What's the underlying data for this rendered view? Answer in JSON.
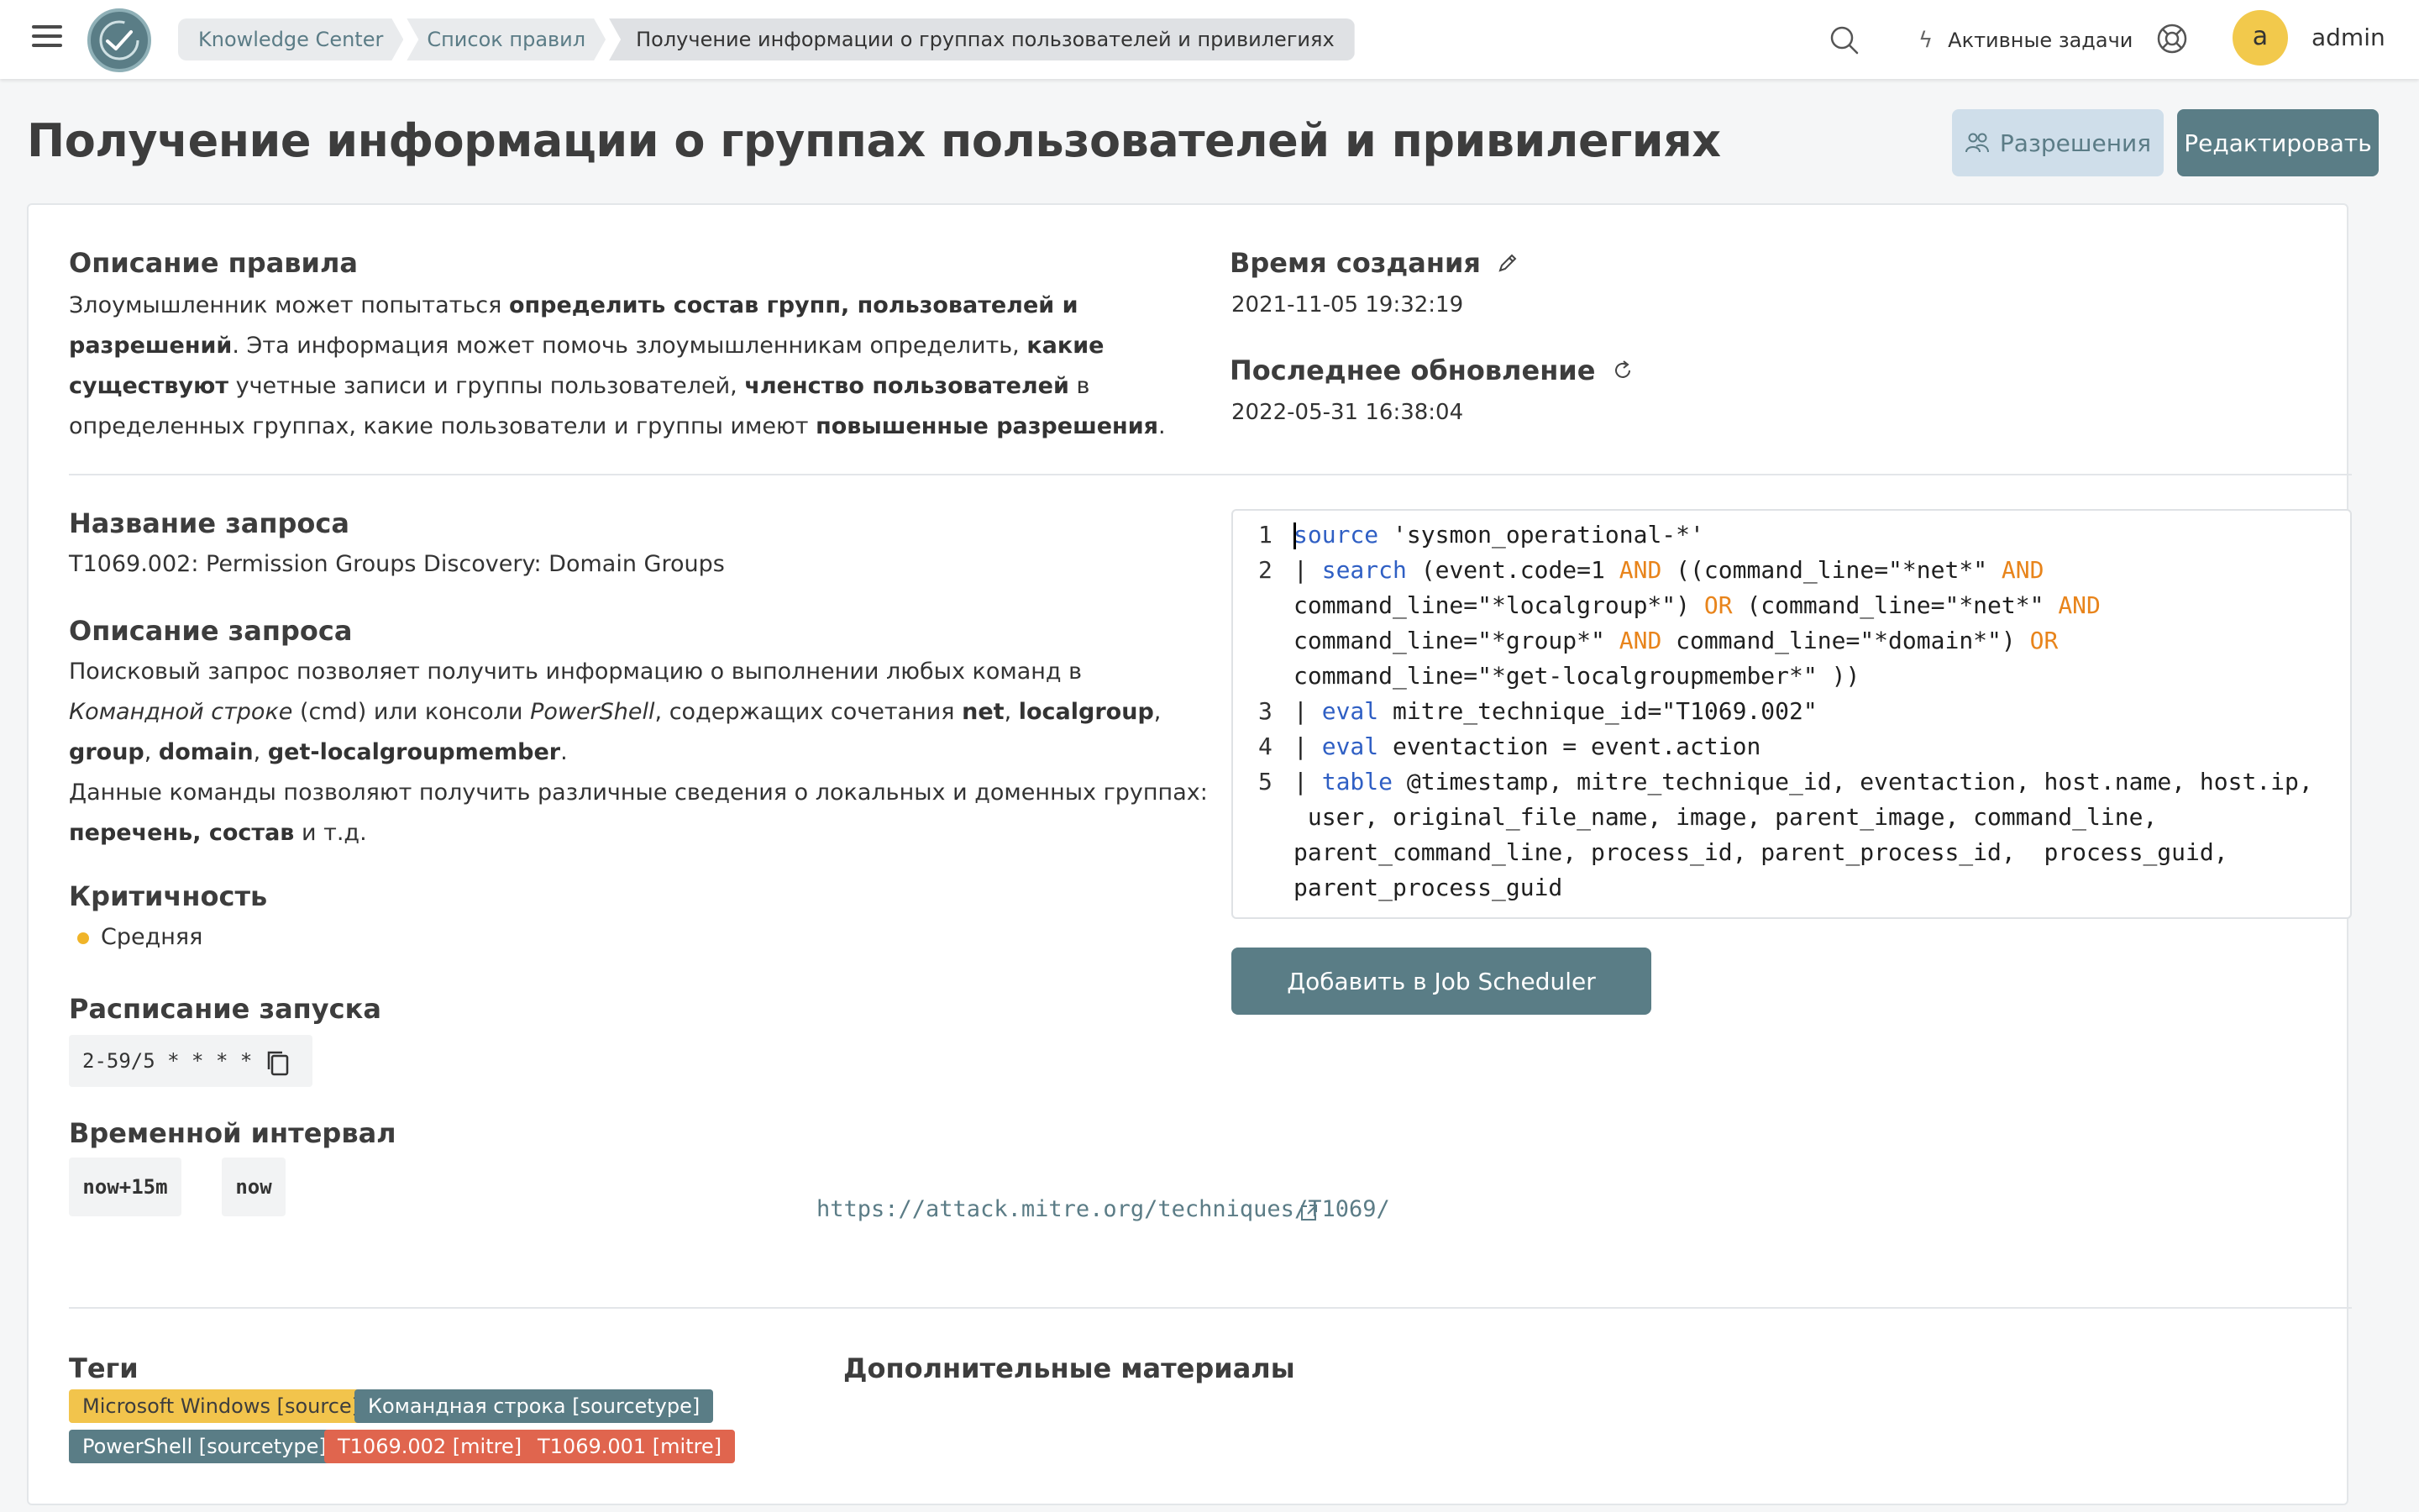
{
  "header": {
    "breadcrumb": [
      "Knowledge Center",
      "Список правил",
      "Получение информации о группах пользователей и привилегиях"
    ],
    "active_tasks_label": "Активные задачи",
    "avatar_letter": "a",
    "username": "admin"
  },
  "page": {
    "title": "Получение информации о группах пользователей и привилегиях",
    "permissions_button": "Разрешения",
    "edit_button": "Редактировать"
  },
  "rule": {
    "description_heading": "Описание правила",
    "description_segments": [
      {
        "text": "Злоумышленник может попытаться ",
        "bold": false
      },
      {
        "text": "определить состав групп, пользователей и разрешений",
        "bold": true
      },
      {
        "text": ". Эта информация может помочь злоумышленникам определить, ",
        "bold": false
      },
      {
        "text": "какие существуют",
        "bold": true
      },
      {
        "text": " учетные записи и группы пользователей, ",
        "bold": false
      },
      {
        "text": "членство пользователей",
        "bold": true
      },
      {
        "text": " в определенных группах, какие пользователи и группы имеют ",
        "bold": false
      },
      {
        "text": "повышенные разрешения",
        "bold": true
      },
      {
        "text": ".",
        "bold": false
      }
    ],
    "created_heading": "Время создания",
    "created_value": "2021-11-05 19:32:19",
    "updated_heading": "Последнее обновление",
    "updated_value": "2022-05-31 16:38:04",
    "query_name_heading": "Название запроса",
    "query_name_value": "T1069.002: Permission Groups Discovery: Domain Groups",
    "query_desc_heading": "Описание запроса",
    "query_desc_segments": [
      {
        "text": "Поисковый запрос позволяет получить информацию о выполнении любых команд в ",
        "style": "normal"
      },
      {
        "text": "Командной строке",
        "style": "italic"
      },
      {
        "text": " (cmd) или консоли ",
        "style": "normal"
      },
      {
        "text": "PowerShell",
        "style": "italic"
      },
      {
        "text": ", содержащих сочетания ",
        "style": "normal"
      },
      {
        "text": "net",
        "style": "bold"
      },
      {
        "text": ", ",
        "style": "normal"
      },
      {
        "text": "localgroup",
        "style": "bold"
      },
      {
        "text": ", ",
        "style": "normal"
      },
      {
        "text": "group",
        "style": "bold"
      },
      {
        "text": ", ",
        "style": "normal"
      },
      {
        "text": "domain",
        "style": "bold"
      },
      {
        "text": ", ",
        "style": "normal"
      },
      {
        "text": "get-localgroupmember",
        "style": "bold"
      },
      {
        "text": ".",
        "style": "normal"
      }
    ],
    "query_desc_segments_2": [
      {
        "text": "Данные команды позволяют получить различные сведения о локальных и доменных группах: ",
        "style": "normal"
      },
      {
        "text": "перечень",
        "style": "bold"
      },
      {
        "text": ", ",
        "style": "bold"
      },
      {
        "text": "состав",
        "style": "bold"
      },
      {
        "text": " и т.д.",
        "style": "normal"
      }
    ],
    "severity_heading": "Критичность",
    "severity_value": "Средняя",
    "severity_color": "#f0b429",
    "schedule_heading": "Расписание запуска",
    "schedule_value": "2-59/5 * * * *",
    "interval_heading": "Временной интервал",
    "interval_from": "now+15m",
    "interval_to": "now",
    "job_button": "Добавить в Job Scheduler",
    "tags_heading": "Теги",
    "tags": [
      {
        "label": "Microsoft Windows [source]",
        "color": "#f2c44c"
      },
      {
        "label": "Командная строка [sourcetype]",
        "color": "#5a7d86"
      },
      {
        "label": "PowerShell [sourcetype]",
        "color": "#5a7d86"
      },
      {
        "label": "T1069.002 [mitre]",
        "color": "#e0654e"
      },
      {
        "label": "T1069.001 [mitre]",
        "color": "#e0654e"
      }
    ],
    "materials_heading": "Дополнительные материалы",
    "materials_link": "https://attack.mitre.org/techniques/T1069/"
  },
  "code": {
    "line_numbers": [
      "1",
      "2",
      "3",
      "4",
      "5"
    ],
    "lines": [
      [
        {
          "t": "source",
          "c": "kw"
        },
        {
          "t": " 'sysmon_operational-*'",
          "c": ""
        }
      ],
      [
        {
          "t": "| ",
          "c": ""
        },
        {
          "t": "search",
          "c": "kw"
        },
        {
          "t": " (event.code=1 ",
          "c": ""
        },
        {
          "t": "AND",
          "c": "op"
        },
        {
          "t": " ((command_line=\"*net*\" ",
          "c": ""
        },
        {
          "t": "AND",
          "c": "op"
        }
      ],
      [
        {
          "t": "command_line=\"*localgroup*\") ",
          "c": ""
        },
        {
          "t": "OR",
          "c": "op"
        },
        {
          "t": " (command_line=\"*net*\" ",
          "c": ""
        },
        {
          "t": "AND",
          "c": "op"
        }
      ],
      [
        {
          "t": "command_line=\"*group*\" ",
          "c": ""
        },
        {
          "t": "AND",
          "c": "op"
        },
        {
          "t": " command_line=\"*domain*\") ",
          "c": ""
        },
        {
          "t": "OR",
          "c": "op"
        }
      ],
      [
        {
          "t": "command_line=\"*get-localgroupmember*\" ))",
          "c": ""
        }
      ],
      [
        {
          "t": "| ",
          "c": ""
        },
        {
          "t": "eval",
          "c": "kw"
        },
        {
          "t": " mitre_technique_id=\"T1069.002\"",
          "c": ""
        }
      ],
      [
        {
          "t": "| ",
          "c": ""
        },
        {
          "t": "eval",
          "c": "kw"
        },
        {
          "t": " eventaction = event.action",
          "c": ""
        }
      ],
      [
        {
          "t": "| ",
          "c": ""
        },
        {
          "t": "table",
          "c": "kw"
        },
        {
          "t": " @timestamp, mitre_technique_id, eventaction, host.name, host.ip,",
          "c": ""
        }
      ],
      [
        {
          "t": " user, original_file_name, image, parent_image, command_line,",
          "c": ""
        }
      ],
      [
        {
          "t": "parent_command_line, process_id, parent_process_id,  process_guid,",
          "c": ""
        }
      ],
      [
        {
          "t": "parent_process_guid",
          "c": ""
        }
      ]
    ]
  }
}
